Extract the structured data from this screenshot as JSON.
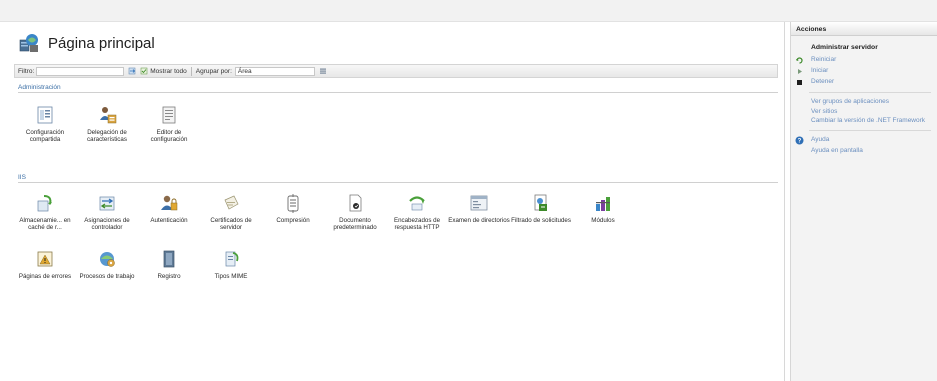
{
  "page": {
    "title": "Página principal"
  },
  "filterbar": {
    "filter_label": "Filtro:",
    "show_all": "Mostrar todo",
    "group_by_label": "Agrupar por:",
    "group_by_value": "Área"
  },
  "sections": {
    "admin": {
      "title": "Administración",
      "items": [
        {
          "label": "Configuración compartida",
          "icon": "shared-config-icon"
        },
        {
          "label": "Delegación de características",
          "icon": "feature-delegation-icon"
        },
        {
          "label": "Editor de configuración",
          "icon": "config-editor-icon"
        }
      ]
    },
    "iis": {
      "title": "IIS",
      "items": [
        {
          "label": "Almacenamie... en caché de r...",
          "icon": "output-cache-icon"
        },
        {
          "label": "Asignaciones de controlador",
          "icon": "handler-mappings-icon"
        },
        {
          "label": "Autenticación",
          "icon": "authentication-icon"
        },
        {
          "label": "Certificados de servidor",
          "icon": "server-certificates-icon"
        },
        {
          "label": "Compresión",
          "icon": "compression-icon"
        },
        {
          "label": "Documento predeterminado",
          "icon": "default-document-icon"
        },
        {
          "label": "Encabezados de respuesta HTTP",
          "icon": "http-headers-icon"
        },
        {
          "label": "Examen de directorios",
          "icon": "directory-browsing-icon"
        },
        {
          "label": "Filtrado de solicitudes",
          "icon": "request-filtering-icon"
        },
        {
          "label": "Módulos",
          "icon": "modules-icon"
        },
        {
          "label": "Páginas de errores",
          "icon": "error-pages-icon"
        },
        {
          "label": "Procesos de trabajo",
          "icon": "worker-processes-icon"
        },
        {
          "label": "Registro",
          "icon": "logging-icon"
        },
        {
          "label": "Tipos MIME",
          "icon": "mime-types-icon"
        }
      ]
    }
  },
  "actions": {
    "header": "Acciones",
    "group_title": "Administrar servidor",
    "manage": [
      {
        "label": "Reiniciar",
        "icon": "restart-icon"
      },
      {
        "label": "Iniciar",
        "icon": "start-icon"
      },
      {
        "label": "Detener",
        "icon": "stop-icon"
      }
    ],
    "links": [
      {
        "label": "Ver grupos de aplicaciones"
      },
      {
        "label": "Ver sitios"
      },
      {
        "label": "Cambiar la versión de .NET Framework"
      }
    ],
    "help": [
      {
        "label": "Ayuda",
        "icon": "help-icon"
      },
      {
        "label": "Ayuda en pantalla"
      }
    ]
  },
  "colors": {
    "link": "#6b8fbf",
    "section_title": "#3a6ea5",
    "accent_blue": "#2f6fb6"
  }
}
